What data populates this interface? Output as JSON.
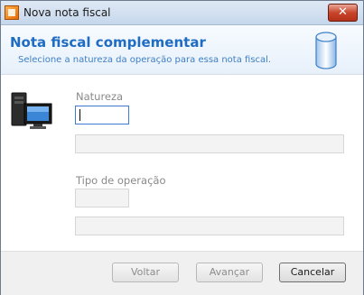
{
  "window": {
    "title": "Nova nota fiscal",
    "close_label": "✕"
  },
  "header": {
    "title": "Nota fiscal complementar",
    "subtitle": "Selecione a natureza da operação para essa nota fiscal."
  },
  "form": {
    "natureza_label": "Natureza",
    "natureza_code_value": "",
    "natureza_description_value": "",
    "tipo_label": "Tipo de operação",
    "tipo_code_value": "",
    "tipo_description_value": ""
  },
  "buttons": {
    "back_label": "Voltar",
    "next_label": "Avançar",
    "cancel_label": "Cancelar"
  },
  "colors": {
    "header_title": "#1f6cc3",
    "header_subtitle": "#3e7fc4",
    "close_button": "#c8452b"
  },
  "icons": {
    "app": "invoice-app-icon",
    "header": "database-icon",
    "side": "computer-icon"
  }
}
